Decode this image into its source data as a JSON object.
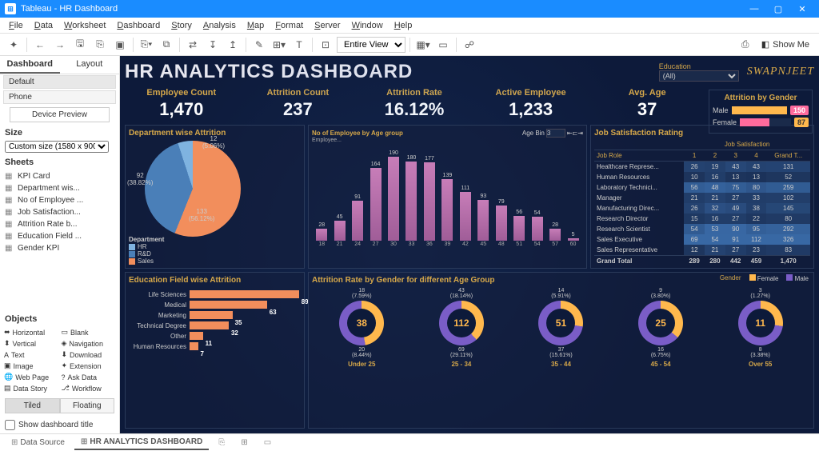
{
  "titlebar": {
    "app": "Tableau",
    "doc": "HR Dashboard"
  },
  "menu": [
    "File",
    "Data",
    "Worksheet",
    "Dashboard",
    "Story",
    "Analysis",
    "Map",
    "Format",
    "Server",
    "Window",
    "Help"
  ],
  "toolbar": {
    "view_mode": "Entire View",
    "showme": "Show Me"
  },
  "leftpanel": {
    "tabs": [
      "Dashboard",
      "Layout"
    ],
    "devices": [
      "Default",
      "Phone"
    ],
    "device_preview": "Device Preview",
    "size_header": "Size",
    "size_value": "Custom size (1580 x 900)",
    "sheets_header": "Sheets",
    "sheets": [
      "KPI Card",
      "Department wis...",
      "No of Employee ...",
      "Job Satisfaction...",
      "Attrition Rate b...",
      "Education Field ...",
      "Gender KPI"
    ],
    "objects_header": "Objects",
    "objects": [
      "Horizontal",
      "Blank",
      "Vertical",
      "Navigation",
      "Text",
      "Download",
      "Image",
      "Extension",
      "Web Page",
      "Ask Data",
      "Data Story",
      "Workflow"
    ],
    "tiled": "Tiled",
    "floating": "Floating",
    "show_title": "Show dashboard title"
  },
  "dashboard": {
    "title": "HR ANALYTICS DASHBOARD",
    "education_label": "Education",
    "education_value": "(All)",
    "logo": "SWAPNJEET",
    "kpis": [
      {
        "label": "Employee Count",
        "value": "1,470"
      },
      {
        "label": "Attrition Count",
        "value": "237"
      },
      {
        "label": "Attrition Rate",
        "value": "16.12%"
      },
      {
        "label": "Active Employee",
        "value": "1,233"
      },
      {
        "label": "Avg. Age",
        "value": "37"
      }
    ],
    "gender": {
      "title": "Attrition by Gender",
      "male_label": "Male",
      "male": "150",
      "female_label": "Female",
      "female": "87"
    },
    "pie": {
      "title": "Department wise Attrition",
      "legend_header": "Department",
      "legend": [
        "HR",
        "R&D",
        "Sales"
      ],
      "slices": [
        {
          "label": "133",
          "pct": "(56.12%)"
        },
        {
          "label": "92",
          "pct": "(38.82%)"
        },
        {
          "label": "12",
          "pct": "(5.06%)"
        }
      ]
    },
    "hist": {
      "title": "No of Employee by Age group",
      "subtitle": "Employee...",
      "agebin_label": "Age Bin",
      "agebin_value": "3"
    },
    "jobsat": {
      "title": "Job Satisfaction Rating",
      "col_header": "Job Satisfaction",
      "role_header": "Job Role",
      "cols": [
        "1",
        "2",
        "3",
        "4",
        "Grand T..."
      ],
      "rows": [
        {
          "role": "Healthcare Represe...",
          "c": [
            "26",
            "19",
            "43",
            "43",
            "131"
          ]
        },
        {
          "role": "Human Resources",
          "c": [
            "10",
            "16",
            "13",
            "13",
            "52"
          ]
        },
        {
          "role": "Laboratory Technici...",
          "c": [
            "56",
            "48",
            "75",
            "80",
            "259"
          ]
        },
        {
          "role": "Manager",
          "c": [
            "21",
            "21",
            "27",
            "33",
            "102"
          ]
        },
        {
          "role": "Manufacturing Direc...",
          "c": [
            "26",
            "32",
            "49",
            "38",
            "145"
          ]
        },
        {
          "role": "Research Director",
          "c": [
            "15",
            "16",
            "27",
            "22",
            "80"
          ]
        },
        {
          "role": "Research Scientist",
          "c": [
            "54",
            "53",
            "90",
            "95",
            "292"
          ]
        },
        {
          "role": "Sales Executive",
          "c": [
            "69",
            "54",
            "91",
            "112",
            "326"
          ]
        },
        {
          "role": "Sales Representative",
          "c": [
            "12",
            "21",
            "27",
            "23",
            "83"
          ]
        }
      ],
      "grand": {
        "role": "Grand Total",
        "c": [
          "289",
          "280",
          "442",
          "459",
          "1,470"
        ]
      }
    },
    "edu": {
      "title": "Education Field wise Attrition",
      "rows": [
        {
          "label": "Life Sciences",
          "v": "89"
        },
        {
          "label": "Medical",
          "v": "63"
        },
        {
          "label": "Marketing",
          "v": "35"
        },
        {
          "label": "Technical Degree",
          "v": "32"
        },
        {
          "label": "Other",
          "v": "11"
        },
        {
          "label": "Human Resources",
          "v": "7"
        }
      ]
    },
    "donuts": {
      "title": "Attrition Rate by Gender for different Age Group",
      "legend": {
        "gender": "Gender",
        "female": "Female",
        "male": "Male"
      },
      "items": [
        {
          "top": "18",
          "top_pct": "(7.59%)",
          "num": "38",
          "bot": "20",
          "bot_pct": "(8.44%)",
          "cat": "Under 25",
          "fdeg": 170
        },
        {
          "top": "43",
          "top_pct": "(18.14%)",
          "num": "112",
          "bot": "69",
          "bot_pct": "(29.11%)",
          "cat": "25 - 34",
          "fdeg": 138
        },
        {
          "top": "14",
          "top_pct": "(5.91%)",
          "num": "51",
          "bot": "37",
          "bot_pct": "(15.61%)",
          "cat": "35 - 44",
          "fdeg": 99
        },
        {
          "top": "9",
          "top_pct": "(3.80%)",
          "num": "25",
          "bot": "16",
          "bot_pct": "(6.75%)",
          "cat": "45 - 54",
          "fdeg": 130
        },
        {
          "top": "3",
          "top_pct": "(1.27%)",
          "num": "11",
          "bot": "8",
          "bot_pct": "(3.38%)",
          "cat": "Over 55",
          "fdeg": 98
        }
      ]
    }
  },
  "chart_data": {
    "histogram": {
      "type": "bar",
      "title": "No of Employee by Age group",
      "xlabel": "Age",
      "ylabel": "Employee Count",
      "categories": [
        "18",
        "21",
        "24",
        "27",
        "30",
        "33",
        "36",
        "39",
        "42",
        "45",
        "48",
        "51",
        "54",
        "57",
        "60"
      ],
      "values": [
        28,
        45,
        91,
        164,
        190,
        180,
        177,
        139,
        111,
        93,
        79,
        56,
        54,
        28,
        5
      ]
    },
    "dept_pie": {
      "type": "pie",
      "title": "Department wise Attrition",
      "slices": [
        {
          "label": "Sales",
          "value": 133,
          "pct": 56.12
        },
        {
          "label": "R&D",
          "value": 92,
          "pct": 38.82
        },
        {
          "label": "HR",
          "value": 12,
          "pct": 5.06
        }
      ]
    },
    "edu_bar": {
      "type": "bar",
      "orientation": "horizontal",
      "title": "Education Field wise Attrition",
      "categories": [
        "Life Sciences",
        "Medical",
        "Marketing",
        "Technical Degree",
        "Other",
        "Human Resources"
      ],
      "values": [
        89,
        63,
        35,
        32,
        11,
        7
      ]
    },
    "gender_bar": {
      "type": "bar",
      "orientation": "horizontal",
      "title": "Attrition by Gender",
      "categories": [
        "Male",
        "Female"
      ],
      "values": [
        150,
        87
      ]
    },
    "jobsat_table": {
      "type": "table",
      "rows_label": "Job Role",
      "cols_label": "Job Satisfaction",
      "cols": [
        1,
        2,
        3,
        4
      ],
      "data": [
        [
          "Healthcare Representative",
          26,
          19,
          43,
          43,
          131
        ],
        [
          "Human Resources",
          10,
          16,
          13,
          13,
          52
        ],
        [
          "Laboratory Technician",
          56,
          48,
          75,
          80,
          259
        ],
        [
          "Manager",
          21,
          21,
          27,
          33,
          102
        ],
        [
          "Manufacturing Director",
          26,
          32,
          49,
          38,
          145
        ],
        [
          "Research Director",
          15,
          16,
          27,
          22,
          80
        ],
        [
          "Research Scientist",
          54,
          53,
          90,
          95,
          292
        ],
        [
          "Sales Executive",
          69,
          54,
          91,
          112,
          326
        ],
        [
          "Sales Representative",
          12,
          21,
          27,
          23,
          83
        ],
        [
          "Grand Total",
          289,
          280,
          442,
          459,
          1470
        ]
      ]
    },
    "attrition_donuts": {
      "type": "pie",
      "multi": true,
      "title": "Attrition Rate by Gender for different Age Group",
      "groups": [
        "Under 25",
        "25 - 34",
        "35 - 44",
        "45 - 54",
        "Over 55"
      ],
      "series": [
        {
          "name": "Female",
          "values": [
            18,
            43,
            14,
            9,
            3
          ]
        },
        {
          "name": "Male",
          "values": [
            20,
            69,
            37,
            16,
            8
          ]
        }
      ],
      "totals": [
        38,
        112,
        51,
        25,
        11
      ]
    }
  },
  "bottomtabs": {
    "datasource": "Data Source",
    "active": "HR ANALYTICS DASHBOARD"
  }
}
